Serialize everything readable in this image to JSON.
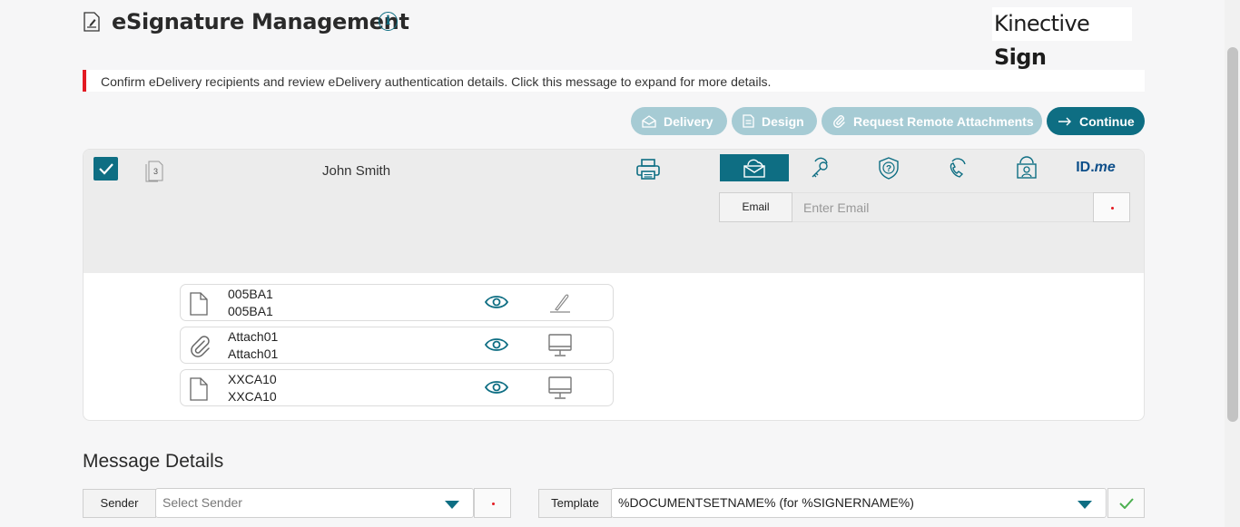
{
  "header": {
    "title": "eSignature Management",
    "info_icon_glyph": "i",
    "logo_text_regular": "Kinective ",
    "logo_text_bold": "Sign"
  },
  "alert": {
    "message": "Confirm eDelivery recipients and review eDelivery authentication details. Click this message to expand for more details.",
    "accent_color": "#e31b23"
  },
  "toolbar": {
    "delivery_label": "Delivery",
    "design_label": "Design",
    "remote_attachments_label": "Request Remote Attachments",
    "continue_label": "Continue"
  },
  "signer": {
    "name": "John Smith",
    "checked": true,
    "doc_count": "3",
    "auth_methods": [
      "email-icon",
      "key-icon",
      "question-shield-icon",
      "phone-icon",
      "id-card-icon",
      "idme-logo"
    ],
    "idme_text_a": "ID.",
    "idme_text_b": "me",
    "email_label": "Email",
    "email_placeholder": "Enter Email",
    "email_value": ""
  },
  "documents": [
    {
      "name": "005BA1",
      "id": "005BA1",
      "type_icon": "document-icon",
      "action_icon": "signature-pen-icon"
    },
    {
      "name": "Attach01",
      "id": "Attach01",
      "type_icon": "paperclip-icon",
      "action_icon": "monitor-icon"
    },
    {
      "name": "XXCA10",
      "id": "XXCA10",
      "type_icon": "document-icon",
      "action_icon": "monitor-icon"
    }
  ],
  "message_details": {
    "title": "Message Details",
    "sender_label": "Sender",
    "sender_placeholder": "Select Sender",
    "template_label": "Template",
    "template_value": "%DOCUMENTSETNAME% (for %SIGNERNAME%)"
  },
  "colors": {
    "accent": "#0e6e83",
    "accent_disabled": "#a6cbd4",
    "required_dot": "#e31b23",
    "success_check": "#4caf50"
  }
}
